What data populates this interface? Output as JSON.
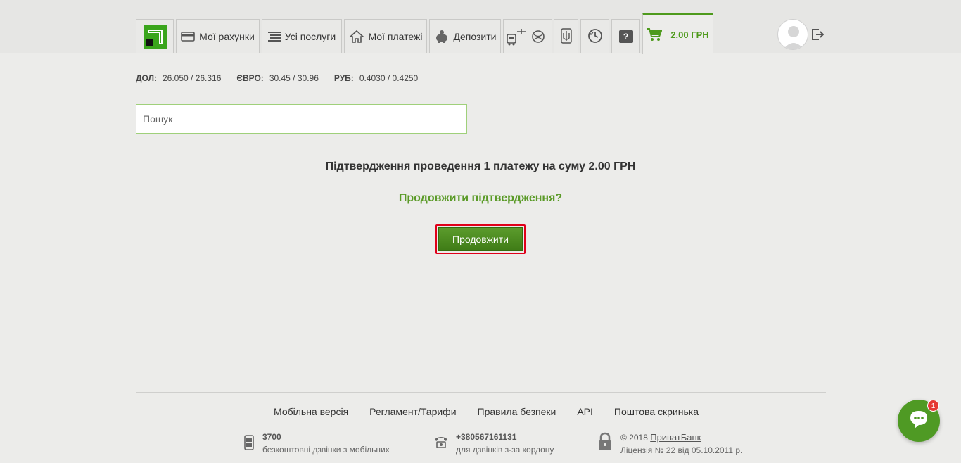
{
  "header": {
    "tabs": {
      "accounts": "Мої рахунки",
      "services": "Усі послуги",
      "payments": "Мої платежі",
      "deposits": "Депозити"
    },
    "help_label": "?",
    "cart_total": "2.00 ГРН"
  },
  "rates": {
    "usd_label": "ДОЛ:",
    "usd_value": "26.050 / 26.316",
    "eur_label": "ЄВРО:",
    "eur_value": "30.45 / 30.96",
    "rub_label": "РУБ:",
    "rub_value": "0.4030 / 0.4250"
  },
  "search": {
    "placeholder": "Пошук"
  },
  "confirmation": {
    "title": "Підтвердження проведення 1 платежу на суму 2.00 ГРН",
    "question": "Продовжити підтвердження?",
    "button": "Продовжити"
  },
  "footer": {
    "links": [
      "Мобільна версія",
      "Регламент/Тарифи",
      "Правила безпеки",
      "API",
      "Поштова скринька"
    ],
    "mobile": {
      "number": "3700",
      "desc": "безкоштовні дзвінки з мобільних"
    },
    "intl": {
      "number": "+380567161131",
      "desc": "для дзвінків з-за кордону"
    },
    "copyright_prefix": "© 2018",
    "bank_name": "ПриватБанк",
    "license": "Ліцензія № 22 від 05.10.2011 р."
  },
  "chat": {
    "badge": "1"
  },
  "colors": {
    "accent": "#4e9a1c",
    "highlight": "#e0001a"
  }
}
